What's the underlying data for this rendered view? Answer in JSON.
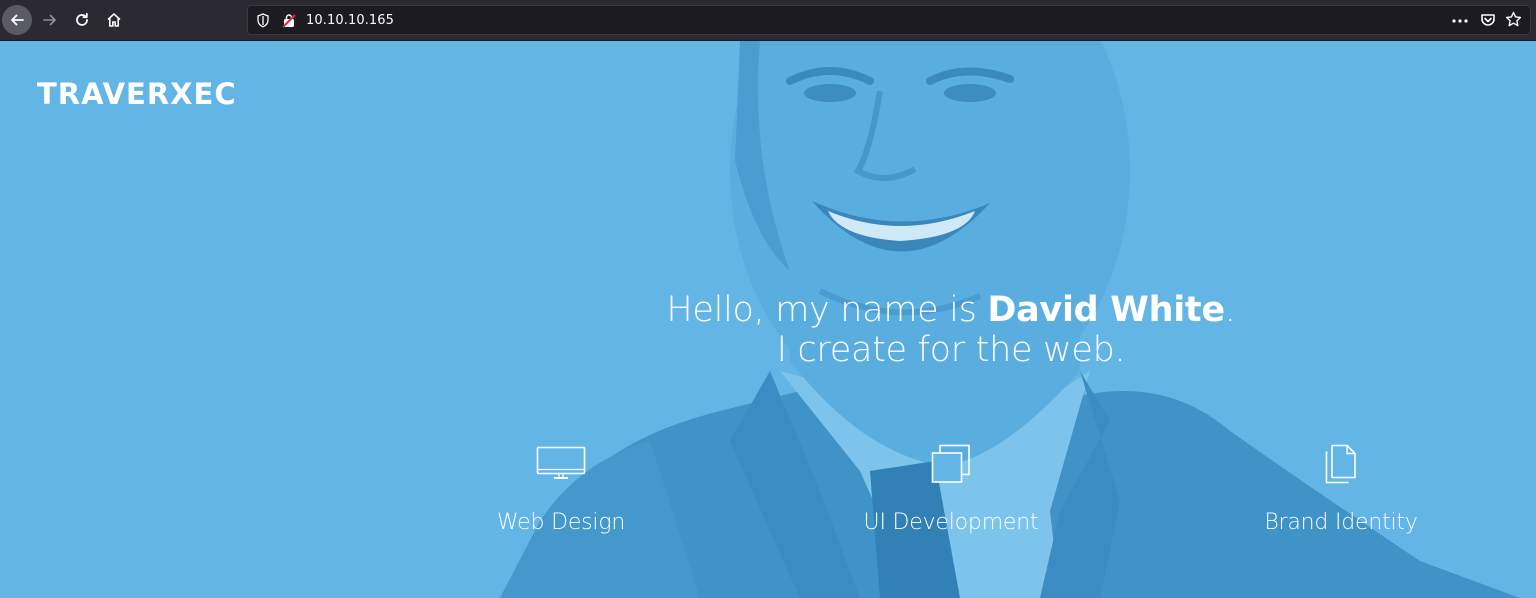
{
  "browser": {
    "url": "10.10.10.165",
    "icons": [
      "back-arrow-icon",
      "forward-arrow-icon",
      "reload-icon",
      "home-icon",
      "shield-icon",
      "insecure-lock-icon",
      "page-actions-icon",
      "pocket-icon",
      "bookmark-star-icon"
    ]
  },
  "site": {
    "logo": "TRAVERXEC"
  },
  "hero": {
    "greeting_prefix": "Hello, my name is ",
    "name": "David White",
    "greeting_suffix": ".",
    "tagline": "I create for the web."
  },
  "services": [
    {
      "label": "Web Design",
      "icon": "monitor-icon"
    },
    {
      "label": "UI Development",
      "icon": "stacked-windows-icon"
    },
    {
      "label": "Brand Identity",
      "icon": "documents-icon"
    }
  ],
  "colors": {
    "hero_blue": "#63b5e5",
    "chrome_dark": "#2b2a33",
    "url_bg": "#1c1b22",
    "text_white": "#ffffff"
  }
}
